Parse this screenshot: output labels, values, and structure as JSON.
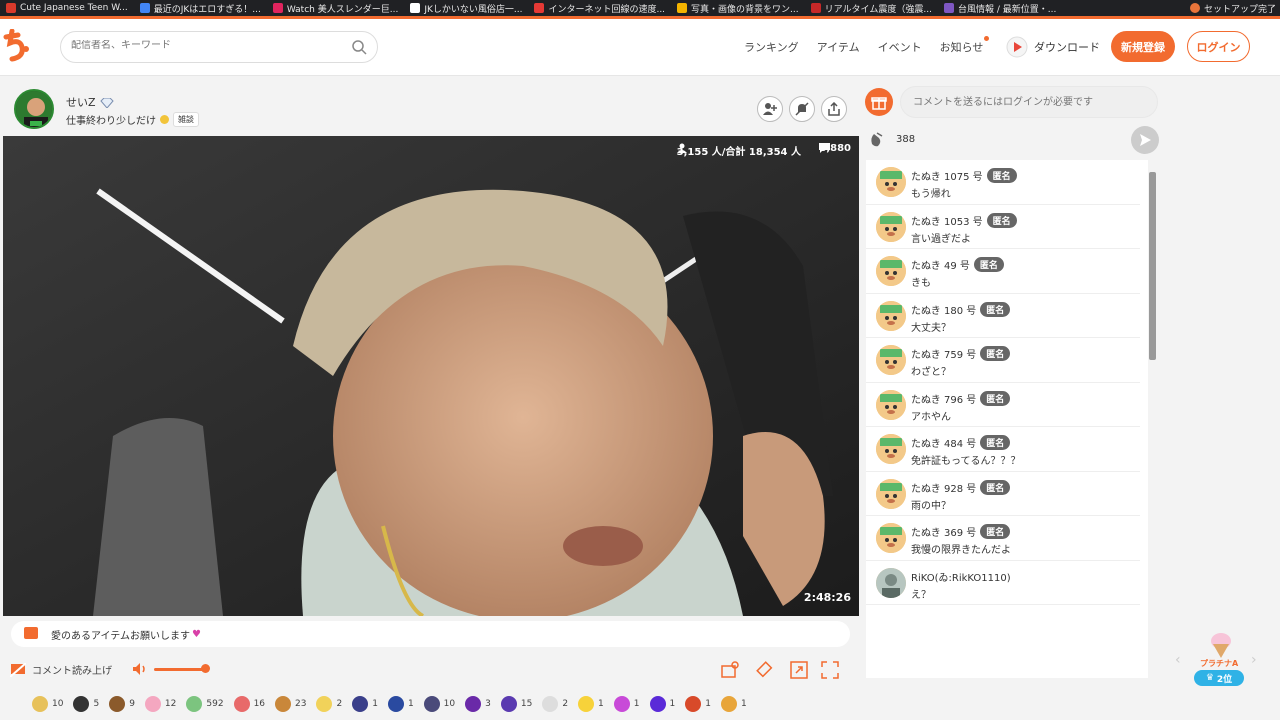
{
  "bookmarks": [
    {
      "label": "Cute Japanese Teen W...",
      "color": "#d93a2b"
    },
    {
      "label": "最近のJKはエロすぎる！...",
      "color": "#4285f4"
    },
    {
      "label": "Watch 美人スレンダー巨...",
      "color": "#e0245e"
    },
    {
      "label": "JKしかいない風俗店一...",
      "color": "#ffffff"
    },
    {
      "label": "インターネット回線の速度...",
      "color": "#e53935"
    },
    {
      "label": "写真・画像の背景をワン...",
      "color": "#f4b400"
    },
    {
      "label": "リアルタイム震度（強震...",
      "color": "#c62828"
    },
    {
      "label": "台風情報 / 最新位置・...",
      "color": "#7e57c2"
    }
  ],
  "bookmarks_right": "セットアップ完了",
  "search": {
    "placeholder": "配信者名、キーワード"
  },
  "nav": {
    "ranking": "ランキング",
    "items": "アイテム",
    "events": "イベント",
    "news": "お知らせ",
    "download": "ダウンロード",
    "register": "新規登録",
    "login": "ログイン"
  },
  "stream": {
    "streamer_name": "せいZ",
    "title": "仕事終わり少しだけ",
    "tag": "雑談",
    "viewers": "3,155 人/合計 18,354 人",
    "comments": "8,880",
    "timer": "2:48:26",
    "notice": "愛のあるアイテムお願いします"
  },
  "controls": {
    "read_aloud": "コメント読み上げ",
    "volume": 0.9
  },
  "items": [
    {
      "count": "10",
      "color": "#e7c15a"
    },
    {
      "count": "5",
      "color": "#333333"
    },
    {
      "count": "9",
      "color": "#8b5a2b"
    },
    {
      "count": "12",
      "color": "#f4a7c0"
    },
    {
      "count": "592",
      "color": "#7cc47f"
    },
    {
      "count": "16",
      "color": "#e86a6a"
    },
    {
      "count": "23",
      "color": "#c9873a"
    },
    {
      "count": "2",
      "color": "#f1d25a"
    },
    {
      "count": "1",
      "color": "#3a3f8a"
    },
    {
      "count": "1",
      "color": "#2a4aa0"
    },
    {
      "count": "10",
      "color": "#4a4a7a"
    },
    {
      "count": "3",
      "color": "#6a2aa8"
    },
    {
      "count": "15",
      "color": "#5a3ab0"
    },
    {
      "count": "2",
      "color": "#dddddd"
    },
    {
      "count": "1",
      "color": "#f7d23a"
    },
    {
      "count": "1",
      "color": "#c84ad8"
    },
    {
      "count": "1",
      "color": "#5a2ad8"
    },
    {
      "count": "1",
      "color": "#d84a2a"
    },
    {
      "count": "1",
      "color": "#e8a53a"
    }
  ],
  "panel": {
    "comment_placeholder": "コメントを送るにはログインが必要です",
    "clap_count": "388",
    "anon_badge": "匿名"
  },
  "chat": [
    {
      "name": "たぬき 1075 号",
      "anon": true,
      "text": "もう帰れ"
    },
    {
      "name": "たぬき 1053 号",
      "anon": true,
      "text": "言い過ぎだよ"
    },
    {
      "name": "たぬき 49 号",
      "anon": true,
      "text": "きも"
    },
    {
      "name": "たぬき 180 号",
      "anon": true,
      "text": "大丈夫？"
    },
    {
      "name": "たぬき 759 号",
      "anon": true,
      "text": "わざと？"
    },
    {
      "name": "たぬき 796 号",
      "anon": true,
      "text": "アホやん"
    },
    {
      "name": "たぬき 484 号",
      "anon": true,
      "text": "免許証もってるん？？？"
    },
    {
      "name": "たぬき 928 号",
      "anon": true,
      "text": "雨の中？"
    },
    {
      "name": "たぬき 369 号",
      "anon": true,
      "text": "我慢の限界きたんだよ"
    },
    {
      "name": "RiKO(ゐ:RikKO1110)",
      "anon": false,
      "text": "え？"
    }
  ],
  "rank": {
    "label": "プラチナA",
    "position": "2位"
  }
}
